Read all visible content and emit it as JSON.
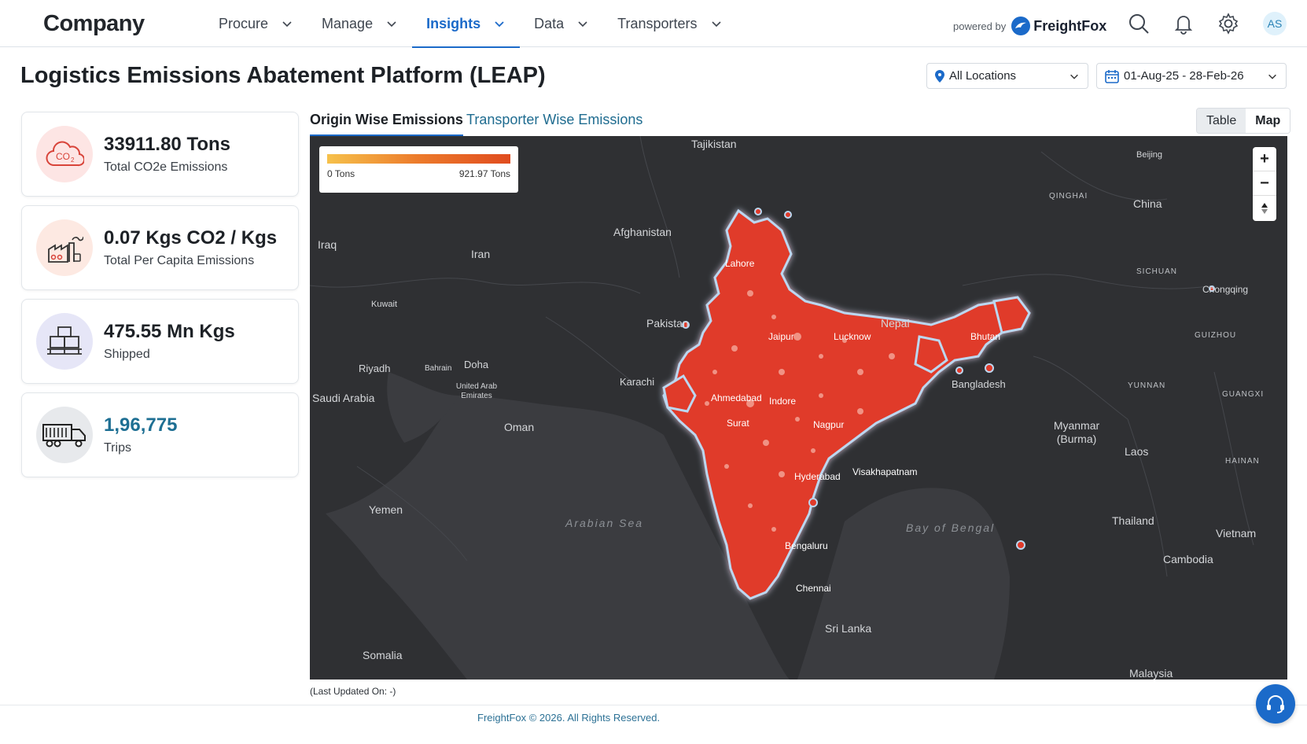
{
  "header": {
    "brand": "Company",
    "nav": [
      {
        "label": "Procure"
      },
      {
        "label": "Manage"
      },
      {
        "label": "Insights",
        "active": true
      },
      {
        "label": "Data"
      },
      {
        "label": "Transporters"
      }
    ],
    "powered_by": "powered by",
    "partner_name": "FreightFox",
    "avatar_initials": "AS"
  },
  "page": {
    "title": "Logistics Emissions Abatement Platform (LEAP)",
    "location_filter": "All Locations",
    "date_range": "01-Aug-25 - 28-Feb-26"
  },
  "stats": [
    {
      "value": "33911.80 Tons",
      "label": "Total CO2e Emissions",
      "icon": "co2-cloud-icon"
    },
    {
      "value": "0.07 Kgs CO2 / Kgs",
      "label": "Total Per Capita Emissions",
      "icon": "factory-emissions-icon"
    },
    {
      "value": "475.55 Mn Kgs",
      "label": "Shipped",
      "icon": "boxes-on-pallet-icon"
    },
    {
      "value": "1,96,775",
      "label": "Trips",
      "icon": "truck-icon"
    }
  ],
  "tabs": [
    {
      "label": "Origin Wise Emissions",
      "active": true
    },
    {
      "label": "Transporter Wise Emissions",
      "active": false
    }
  ],
  "view_toggle": {
    "table": "Table",
    "map": "Map",
    "selected": "Map"
  },
  "map": {
    "legend": {
      "min": "0 Tons",
      "max": "921.97 Tons"
    },
    "labels": {
      "tajikistan": "Tajikistan",
      "beijing": "Beijing",
      "qinghai": "QINGHAI",
      "china": "China",
      "afghanistan": "Afghanistan",
      "iraq": "Iraq",
      "iran": "Iran",
      "lahore": "Lahore",
      "sichuan": "SICHUAN",
      "chongqing": "Chongqing",
      "kuwait": "Kuwait",
      "pakistan": "Pakistan",
      "nepal": "Nepal",
      "bhutan": "Bhutan",
      "guizhou": "GUIZHOU",
      "riyadh": "Riyadh",
      "bahrain": "Bahrain",
      "doha": "Doha",
      "karachi": "Karachi",
      "uae": "United Arab Emirates",
      "saudi_arabia": "Saudi Arabia",
      "bangladesh": "Bangladesh",
      "yunnan": "YUNNAN",
      "guangxi": "GUANGXI",
      "oman": "Oman",
      "myanmar": "Myanmar (Burma)",
      "laos": "Laos",
      "hainan": "HAINAN",
      "yemen": "Yemen",
      "arabian_sea": "Arabian Sea",
      "bay_of_bengal": "Bay of Bengal",
      "thailand": "Thailand",
      "vietnam": "Vietnam",
      "cambodia": "Cambodia",
      "sri_lanka": "Sri Lanka",
      "somalia": "Somalia",
      "malaysia": "Malaysia",
      "jaipur": "Jaipur",
      "lucknow": "Lucknow",
      "ahmedabad": "Ahmedabad",
      "indore": "Indore",
      "hyderabad": "Hyderabad",
      "bengaluru": "Bengaluru",
      "chennai": "Chennai",
      "surat": "Surat",
      "nagpur": "Nagpur",
      "visakhapatnam": "Visakhapatnam"
    }
  },
  "last_updated": "(Last Updated On: -)",
  "footer": "FreightFox © 2026. All Rights Reserved.",
  "colors": {
    "accent": "#1b6ac9",
    "heat": "#e03a2a",
    "map_bg": "#2f3033"
  }
}
